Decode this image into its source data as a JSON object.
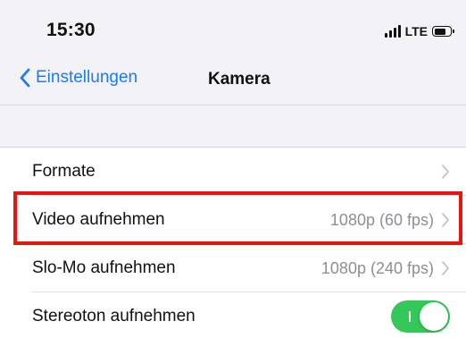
{
  "status_bar": {
    "time": "15:30",
    "network": "LTE"
  },
  "nav": {
    "back_label": "Einstellungen",
    "title": "Kamera"
  },
  "rows": [
    {
      "label": "Formate",
      "value": "",
      "control": "chevron"
    },
    {
      "label": "Video aufnehmen",
      "value": "1080p (60 fps)",
      "control": "chevron"
    },
    {
      "label": "Slo-Mo aufnehmen",
      "value": "1080p (240 fps)",
      "control": "chevron"
    },
    {
      "label": "Stereoton aufnehmen",
      "value": "",
      "control": "toggle",
      "toggle_on": true
    }
  ],
  "colors": {
    "accent": "#1a7cf0",
    "toggle_on": "#34c759",
    "highlight": "#e8140f",
    "secondary_text": "#8e8e93"
  },
  "icons": {
    "back": "chevron-left-icon",
    "row_disclosure": "chevron-right-icon",
    "signal": "cellular-signal-icon",
    "battery": "battery-icon"
  }
}
